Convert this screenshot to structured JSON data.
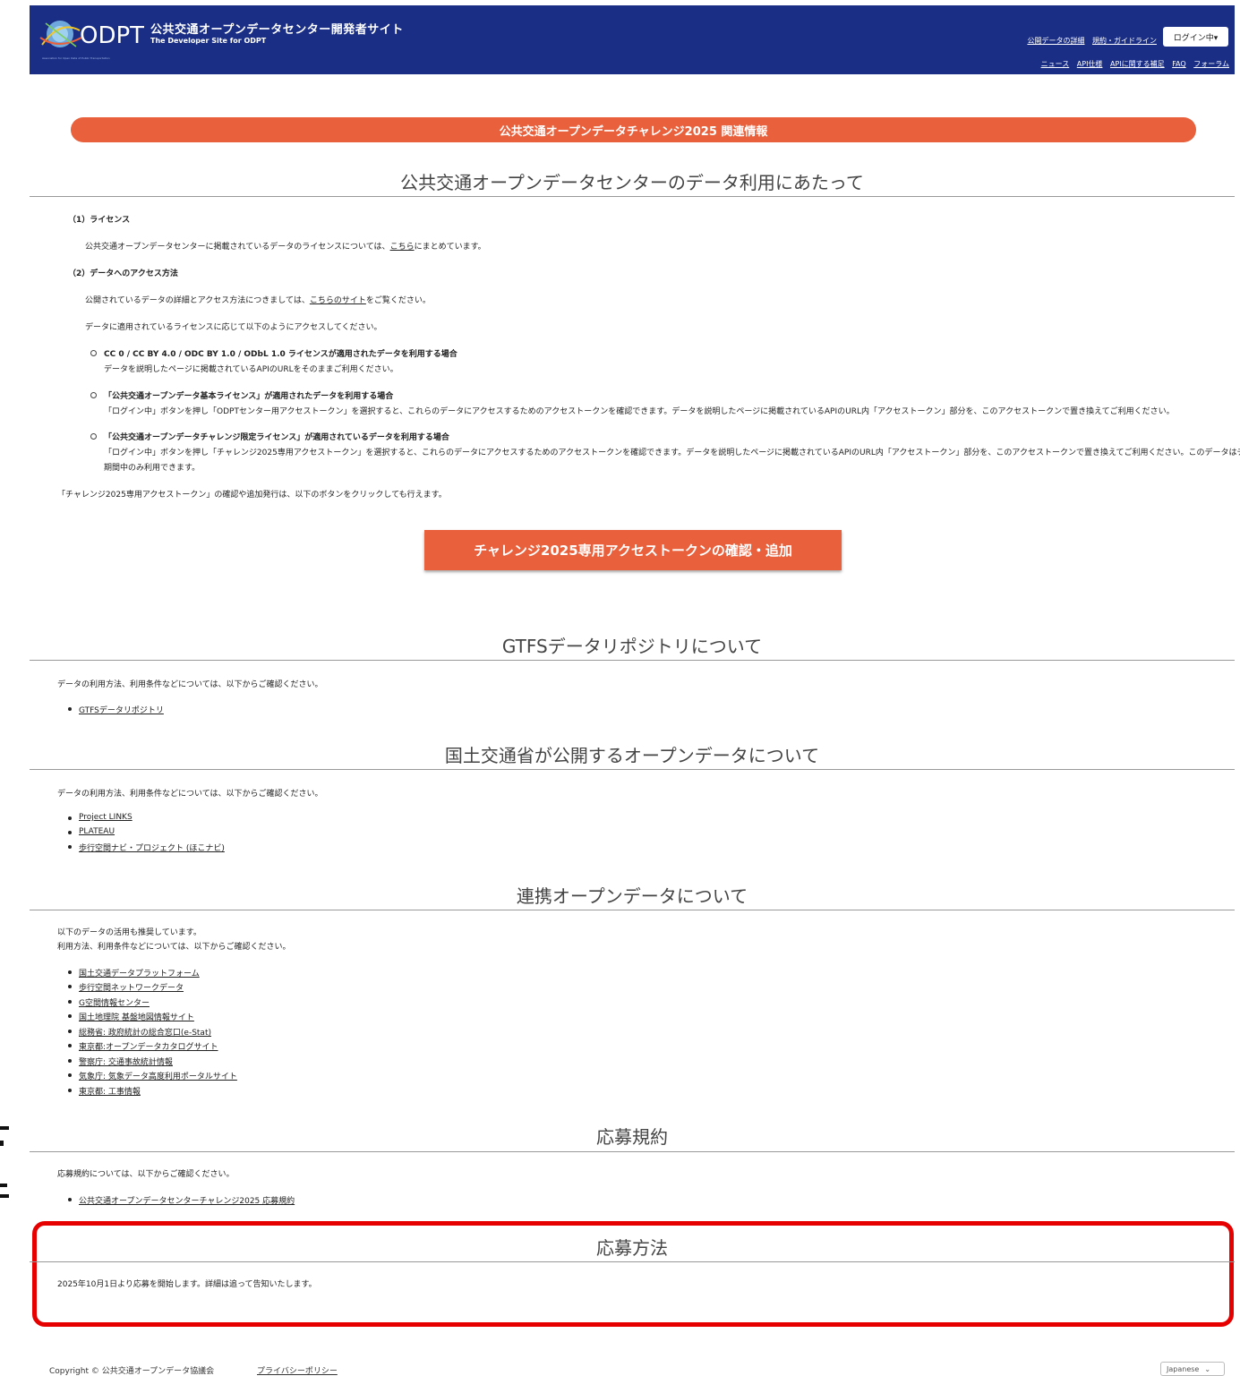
{
  "header": {
    "title": "公共交通オープンデータセンター開発者サイト",
    "subtitle": "The Developer Site for ODPT",
    "logo_text": "ODPT",
    "nav_primary": [
      "公開データの詳細",
      "規約・ガイドライン"
    ],
    "login_label": "ログイン中▾",
    "nav_secondary": [
      "ニュース",
      "API仕様",
      "APIに関する補足",
      "FAQ",
      "フォーラム"
    ]
  },
  "banner": {
    "label": "公共交通オープンデータチャレンジ2025 関連情報"
  },
  "section1": {
    "title": "公共交通オープンデータセンターのデータ利用にあたって",
    "license_heading": "（1）ライセンス",
    "license_text_pre": "公共交通オープンデータセンターに掲載されているデータのライセンスについては、",
    "license_link": "こちら",
    "license_text_post": "にまとめています。",
    "access_heading": "（2）データへのアクセス方法",
    "access_text_pre": "公開されているデータの詳細とアクセス方法につきましては、",
    "access_link": "こちらのサイト",
    "access_text_post": "をご覧ください。",
    "access_intro": "データに適用されているライセンスに応じて以下のようにアクセスしてください。",
    "items": [
      {
        "heading": "CC 0 / CC BY 4.0 / ODC BY 1.0 / ODbL 1.0 ライセンスが適用されたデータを利用する場合",
        "line1": "データを説明したページに掲載されているAPIのURLをそのままご利用ください。",
        "line2": ""
      },
      {
        "heading": "「公共交通オープンデータ基本ライセンス」が適用されたデータを利用する場合",
        "line1": "「ログイン中」ボタンを押し「ODPTセンター用アクセストークン」を選択すると、これらのデータにアクセスするためのアクセストークンを確認できます。データを説明したページに掲載されているAPIのURL内「アクセストークン」部分を、このアクセストークンで置き換えてご利用ください。",
        "line2": ""
      },
      {
        "heading": "「公共交通オープンデータチャレンジ限定ライセンス」が適用されているデータを利用する場合",
        "line1": "「ログイン中」ボタンを押し「チャレンジ2025専用アクセストークン」を選択すると、これらのデータにアクセスするためのアクセストークンを確認できます。データを説明したページに掲載されているAPIのURL内「アクセストークン」部分を、このアクセストークンで置き換えてご利用ください。このデータはチャレンジ",
        "line2": "期間中のみ利用できます。"
      }
    ],
    "token_note": "「チャレンジ2025専用アクセストークン」の確認や追加発行は、以下のボタンをクリックしても行えます。",
    "cta_label": "チャレンジ2025専用アクセストークンの確認・追加"
  },
  "section2": {
    "title": "GTFSデータリポジトリについて",
    "intro": "データの利用方法、利用条件などについては、以下からご確認ください。",
    "links": [
      "GTFSデータリポジトリ"
    ]
  },
  "section3": {
    "title": "国土交通省が公開するオープンデータについて",
    "intro": "データの利用方法、利用条件などについては、以下からご確認ください。",
    "links": [
      "Project LINKS",
      "PLATEAU",
      "歩行空間ナビ・プロジェクト (ほこナビ)"
    ]
  },
  "section4": {
    "title": "連携オープンデータについて",
    "intro1": "以下のデータの活用も推奨しています。",
    "intro2": "利用方法、利用条件などについては、以下からご確認ください。",
    "links": [
      "国土交通データプラットフォーム",
      "歩行空間ネットワークデータ",
      "G空間情報センター",
      "国土地理院 基盤地図情報サイト",
      "総務省: 政府統計の総合窓口(e-Stat)",
      "東京都:オープンデータカタログサイト",
      "警察庁: 交通事故統計情報",
      "気象庁: 気象データ高度利用ポータルサイト",
      "東京都: 工事情報"
    ]
  },
  "section5": {
    "title": "応募規約",
    "intro": "応募規約については、以下からご確認ください。",
    "links": [
      "公共交通オープンデータセンターチャレンジ2025 応募規約"
    ]
  },
  "section6": {
    "title": "応募方法",
    "text": "2025年10月1日より応募を開始します。詳細は追って告知いたします。"
  },
  "footer": {
    "copyright": "Copyright © 公共交通オープンデータ協議会",
    "privacy": "プライバシーポリシー",
    "language": "Japanese"
  },
  "colors": {
    "header_bg": "#1a2e85",
    "accent": "#e8603c",
    "highlight": "#e60000"
  }
}
